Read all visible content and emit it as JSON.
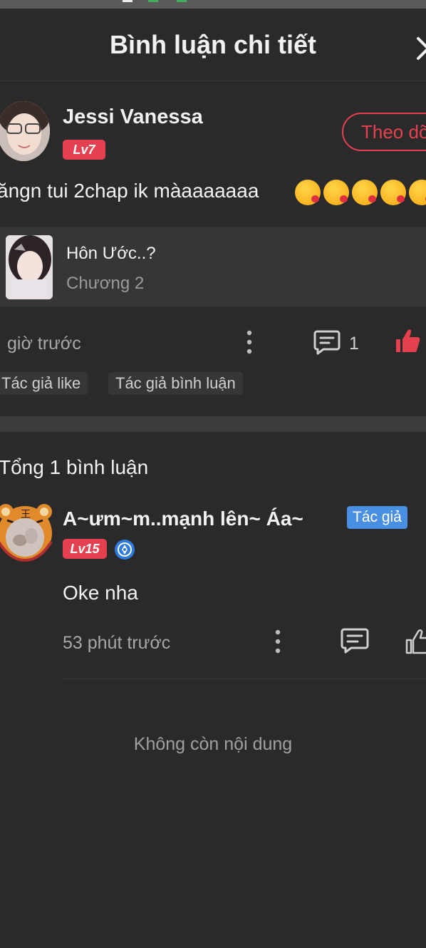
{
  "header": {
    "title": "Bình luận chi tiết",
    "close_icon": "close-icon"
  },
  "comment": {
    "username": "Jessi Vanessa",
    "level": "Lv7",
    "follow_label": "Theo dõ",
    "text": "ăngn tui 2chap ik màaaaaaaa",
    "emoji_icon": "kissing-face-emoji",
    "chapter": {
      "title": "Hôn Ước..?",
      "subtitle": "Chương 2"
    },
    "time": "giờ trước",
    "reply_count": "1",
    "tags": [
      "Tác giả like",
      "Tác giả bình luận"
    ],
    "colors": {
      "accent": "#e5404f",
      "badge_blue": "#4a90e2"
    }
  },
  "replies_section": {
    "total_label": "Tổng 1 bình luận",
    "reply": {
      "username": "A~ưm~m..mạnh lên~ Áa~",
      "author_badge": "Tác giả",
      "level": "Lv15",
      "text": "Oke nha",
      "time": "53 phút trước"
    },
    "end_label": "Không còn nội dung"
  }
}
